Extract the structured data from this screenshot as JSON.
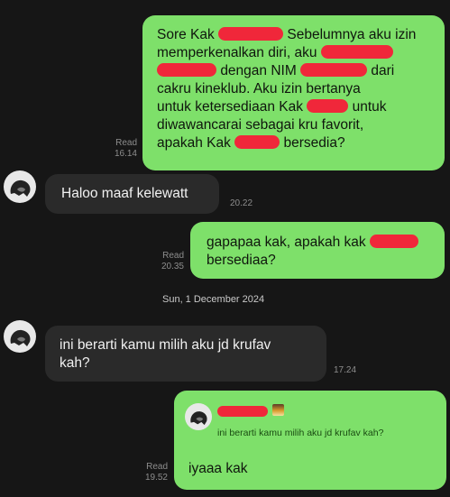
{
  "messages": {
    "m1": {
      "lines": [
        [
          "Sore Kak",
          "Sebelumnya aku izin"
        ],
        [
          "memperkenalkan diri, aku",
          ""
        ],
        [
          "",
          "dengan NIM",
          "dari"
        ],
        [
          "cakru kineklub. Aku izin bertanya"
        ],
        [
          "untuk ketersediaan Kak",
          "untuk"
        ],
        [
          "diwawancarai sebagai kru favorit,"
        ],
        [
          "apakah Kak",
          "bersedia?"
        ]
      ],
      "status": "Read",
      "time": "16.14"
    },
    "m2": {
      "text": "Haloo maaf kelewatt",
      "time": "20.22"
    },
    "m3": {
      "line1": "gapapaa kak, apakah kak",
      "line2": "bersediaa?",
      "status": "Read",
      "time": "20.35"
    },
    "date_separator": "Sun, 1 December 2024",
    "m4": {
      "line1": "ini berarti kamu milih aku jd krufav",
      "line2": "kah?",
      "time": "17.24"
    },
    "m5": {
      "quote_text": "ini berarti kamu milih aku jd krufav kah?",
      "text": "iyaaa kak",
      "status": "Read",
      "time": "19.52"
    }
  },
  "colors": {
    "outgoing_bubble": "#7ee06a",
    "incoming_bubble": "#2a2a2a",
    "background": "#161616",
    "redaction": "#f0273a"
  }
}
